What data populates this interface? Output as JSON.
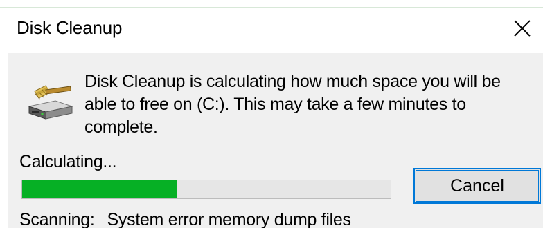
{
  "window": {
    "title": "Disk Cleanup",
    "close_glyph": "✕"
  },
  "dialog": {
    "icon": "disk-cleanup-drive-icon",
    "message": "Disk Cleanup is calculating how much space you will be able to free on  (C:). This may take a few minutes to complete.",
    "status_label": "Calculating...",
    "progress_fraction": 0.42,
    "progress_color": "#06b025",
    "cancel_label": "Cancel",
    "scanning_label": "Scanning:",
    "scanning_item": "System error memory dump files"
  },
  "colors": {
    "accent": "#0078d7",
    "dialog_background": "#f0f0f0"
  }
}
